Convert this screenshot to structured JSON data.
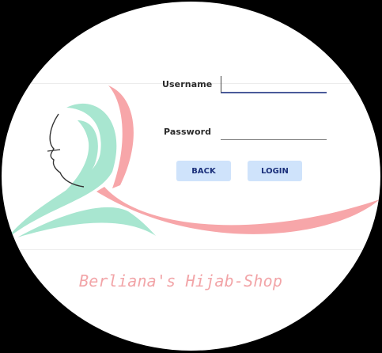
{
  "form": {
    "username_label": "Username",
    "username_value": "",
    "password_label": "Password",
    "password_value": ""
  },
  "buttons": {
    "back_label": "BACK",
    "login_label": "LOGIN"
  },
  "brand": {
    "shop_name": "Berliana's Hijab-Shop",
    "logo_icon": "hijab-woman-silhouette-icon",
    "pink": "#f7a6a9",
    "mint": "#a8e6d0"
  }
}
